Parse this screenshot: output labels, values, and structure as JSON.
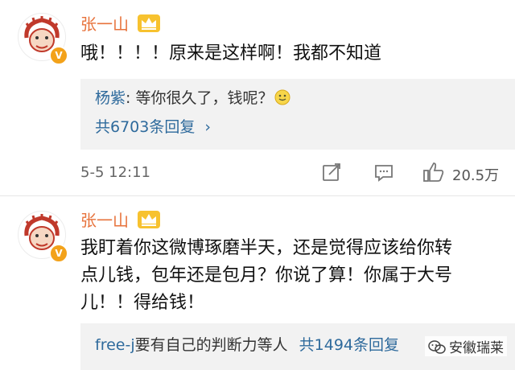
{
  "comments": [
    {
      "author": "张一山",
      "text_lines": [
        "哦！！！！原来是这样啊！我都不知道"
      ],
      "reply": {
        "author": "杨紫",
        "sep": ": ",
        "text": "等你很久了，钱呢？",
        "more_label": "共6703条回复",
        "more_chevron": "›"
      },
      "date": "5-5 12:11",
      "likes": "20.5万",
      "icons": [
        "share-icon",
        "comment-icon",
        "like-icon"
      ]
    },
    {
      "author": "张一山",
      "text_lines": [
        "我盯着你这微博琢磨半天，还是觉得应该给你转",
        "点儿钱，包年还是包月？你说了算！你属于大号",
        "儿！！得给钱！"
      ],
      "reply": {
        "author": "free-j",
        "text": "要有自己的判断力等人",
        "more_label": "共1494条回复"
      }
    }
  ],
  "watermark": {
    "text": "安徽瑞莱",
    "icon": "wechat-icon"
  },
  "colors": {
    "name": "#e7723b",
    "link": "#2e6a9c",
    "reply_bg": "#f2f2f2",
    "badge": "#f3a21a"
  }
}
